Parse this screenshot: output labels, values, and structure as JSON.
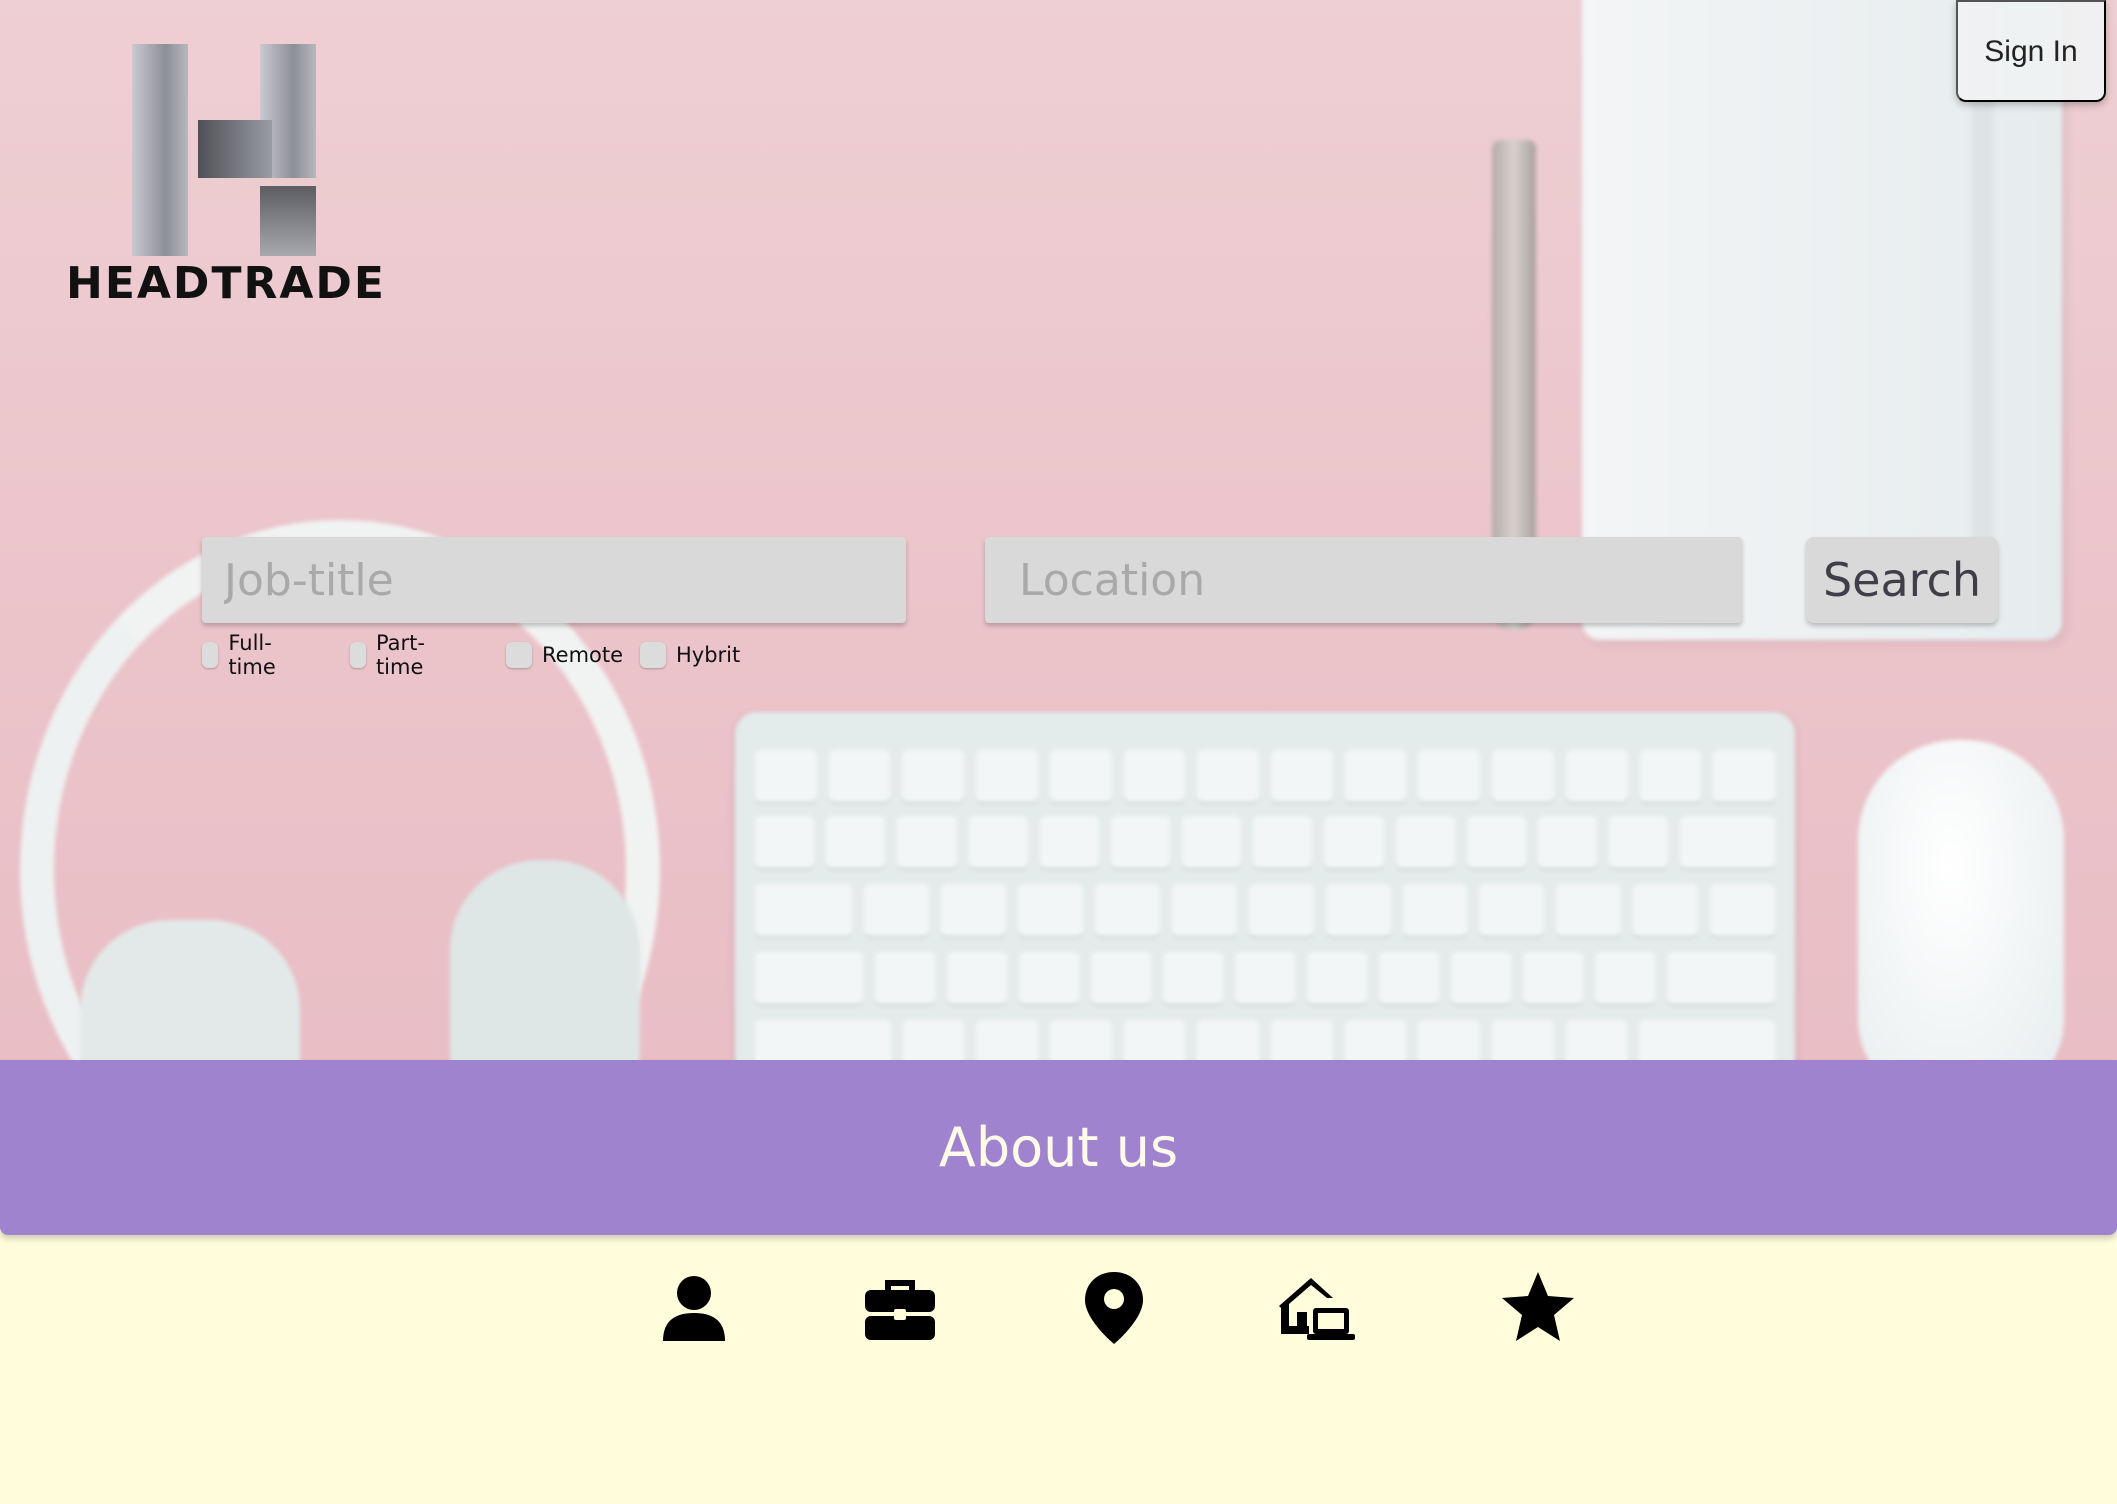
{
  "brand": {
    "logo_text": "HEADTRADE"
  },
  "header": {
    "signin_label": "Sign In"
  },
  "search": {
    "job_placeholder": "Job-title",
    "location_placeholder": "Location",
    "button_label": "Search",
    "filters": [
      {
        "label": "Full-time",
        "checked": false
      },
      {
        "label": "Part-time",
        "checked": false
      },
      {
        "label": "Remote",
        "checked": false
      },
      {
        "label": "Hybrit",
        "checked": false
      }
    ]
  },
  "about": {
    "title": "About us"
  },
  "feature_icons": [
    "person-icon",
    "briefcase-icon",
    "location-pin-icon",
    "home-office-icon",
    "star-icon"
  ],
  "colors": {
    "hero_background": "#ecc8cd",
    "about_band": "#9f83ce",
    "page_background": "#fffddc",
    "input_background": "#d9d9d9"
  }
}
